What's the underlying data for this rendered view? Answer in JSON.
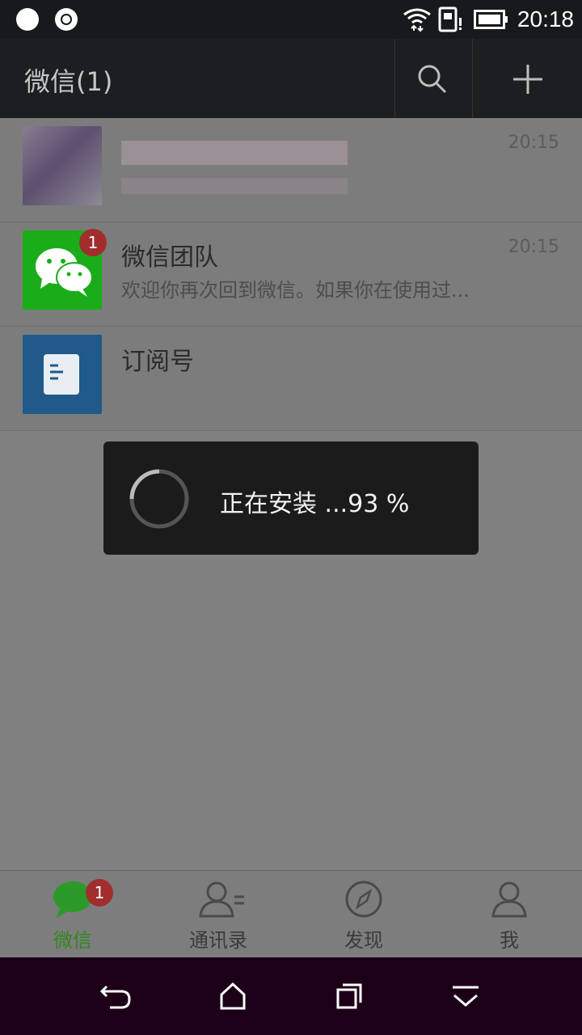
{
  "status_bar": {
    "time": "20:18"
  },
  "app_bar": {
    "title": "微信(1)"
  },
  "conversations": [
    {
      "name": "",
      "time": "20:15",
      "message": "",
      "blurred": true
    },
    {
      "name": "微信团队",
      "time": "20:15",
      "message": "欢迎你再次回到微信。如果你在使用过...",
      "badge": "1"
    },
    {
      "name": "订阅号",
      "time": "",
      "message": ""
    }
  ],
  "dialog": {
    "text": "正在安装 ...93 %"
  },
  "tabs": [
    {
      "label": "微信",
      "badge": "1",
      "active": true
    },
    {
      "label": "通讯录",
      "active": false
    },
    {
      "label": "发现",
      "active": false
    },
    {
      "label": "我",
      "active": false
    }
  ],
  "colors": {
    "wechat_green": "#1aad19",
    "badge_red": "#a22d2d",
    "active_tab": "#2f8a1e"
  }
}
